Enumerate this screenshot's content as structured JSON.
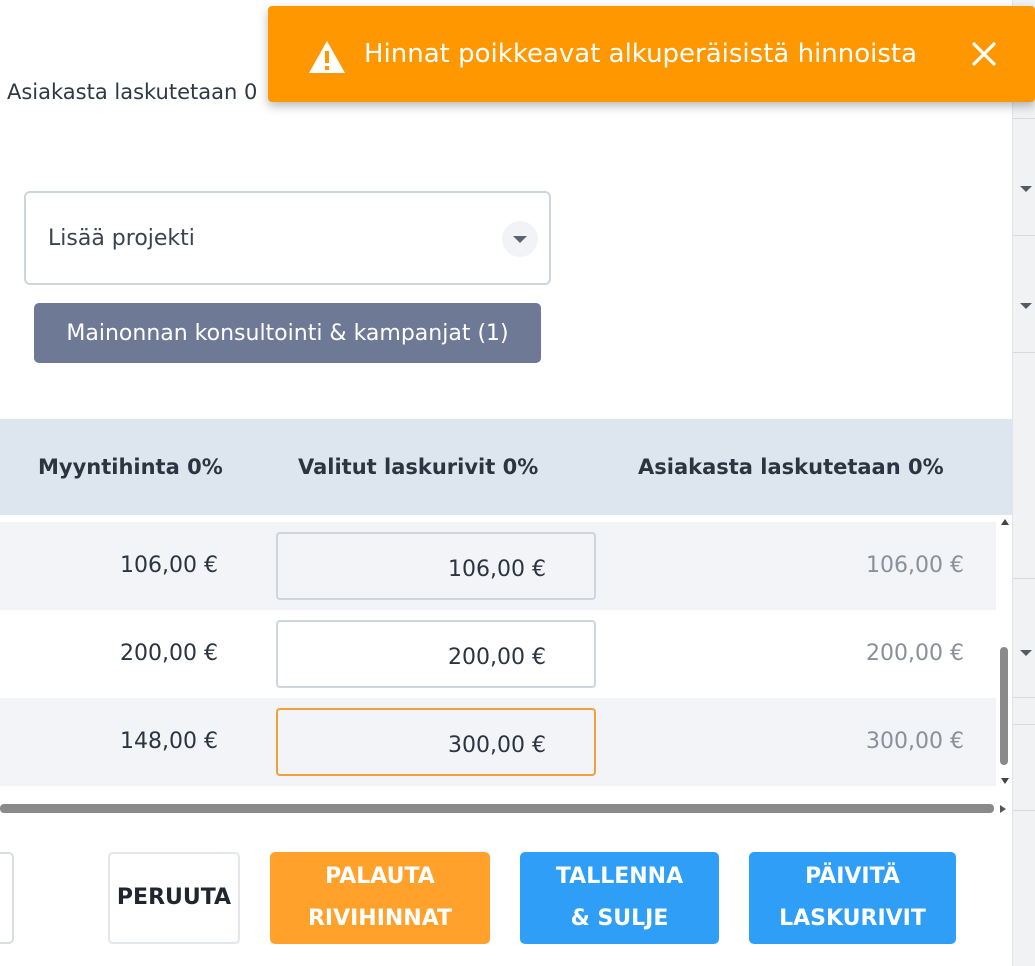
{
  "header": {
    "invoice_text": "Asiakasta laskutetaan 0"
  },
  "toast": {
    "message": "Hinnat poikkeavat alkuperäisistä hinnoista",
    "color": "#ff9800"
  },
  "project": {
    "placeholder": "Lisää projekti",
    "chip_label": "Mainonnan konsultointi & kampanjat (1)"
  },
  "table": {
    "columns": [
      "Myyntihinta 0%",
      "Valitut laskurivit 0%",
      "Asiakasta laskutetaan 0%"
    ],
    "rows": [
      {
        "sale_price": "106,00 €",
        "selected": "106,00 €",
        "billed": "106,00 €"
      },
      {
        "sale_price": "200,00 €",
        "selected": "200,00 €",
        "billed": "200,00 €"
      },
      {
        "sale_price": "148,00 €",
        "selected": "300,00 €",
        "billed": "300,00 €"
      }
    ]
  },
  "buttons": {
    "cancel": "PERUUTA",
    "restore": "PALAUTA\nRIVIHINNAT",
    "save_close": "TALLENNA\n& SULJE",
    "update": "PÄIVITÄ\nLASKURIVIT"
  },
  "colors": {
    "orange": "#ffa12b",
    "blue": "#2e9ef7",
    "chip": "#6e7a95",
    "header_bg": "#dde6ef"
  }
}
